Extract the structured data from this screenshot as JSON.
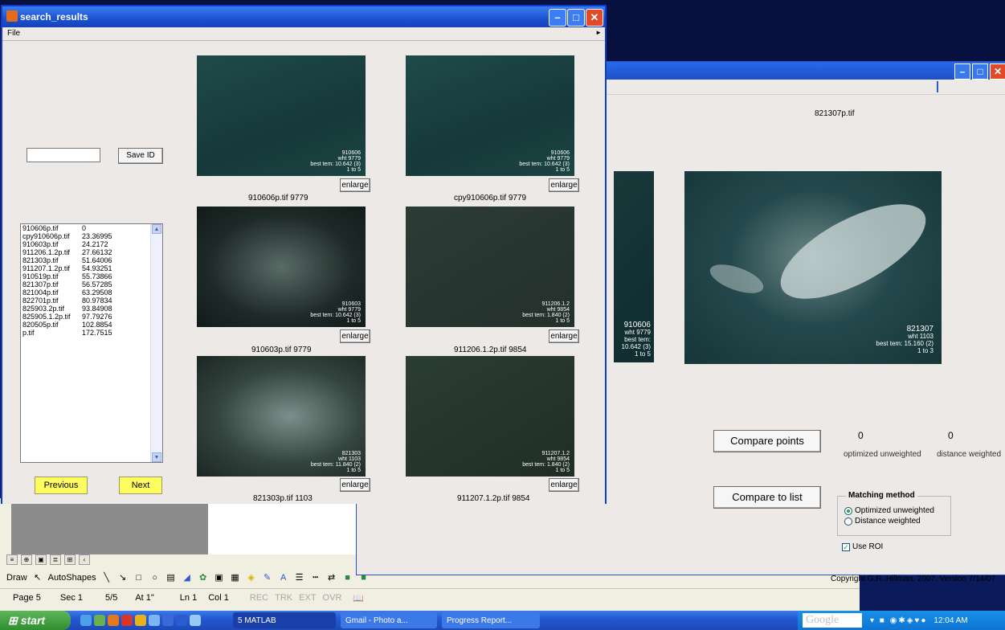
{
  "search_window": {
    "title": "search_results",
    "menu_file": "File",
    "save_id_label": "Save ID",
    "id_input_value": "",
    "results_list": [
      {
        "file": "910606p.tif",
        "score": "0"
      },
      {
        "file": "cpy910606p.tif",
        "score": "23.36995"
      },
      {
        "file": "910603p.tif",
        "score": "24.2172"
      },
      {
        "file": "911206.1.2p.tif",
        "score": "27.66132"
      },
      {
        "file": "821303p.tif",
        "score": "51.64006"
      },
      {
        "file": "911207.1.2p.tif",
        "score": "54.93251"
      },
      {
        "file": "910519p.tif",
        "score": "55.73866"
      },
      {
        "file": "821307p.tif",
        "score": "56.57285"
      },
      {
        "file": "821004p.tif",
        "score": "63.29508"
      },
      {
        "file": "822701p.tif",
        "score": "80.97834"
      },
      {
        "file": "825903.2p.tif",
        "score": "93.84908"
      },
      {
        "file": "825905.1.2p.tif",
        "score": "97.79276"
      },
      {
        "file": "820505p.tif",
        "score": "102.8854"
      },
      {
        "file": "p.tif",
        "score": "172.7515"
      }
    ],
    "previous_label": "Previous",
    "next_label": "Next",
    "enlarge_label": "enlarge",
    "thumbnails": [
      {
        "caption": "910606p.tif    9779",
        "overlay": [
          "910606",
          "wht 9779",
          "best tem: 10.642 (3)",
          "1 to 5"
        ]
      },
      {
        "caption": "cpy910606p.tif 9779",
        "overlay": [
          "910606",
          "wht 9779",
          "best tem: 10.642 (3)",
          "1 to 5"
        ]
      },
      {
        "caption": "910603p.tif 9779",
        "overlay": [
          "910603",
          "wht 9779",
          "best tem: 10.642 (3)",
          "1 to 5"
        ]
      },
      {
        "caption": "911206.1.2p.tif 9854",
        "overlay": [
          "911206.1.2",
          "wht 9854",
          "best tem: 1.840 (2)",
          "1 to 5"
        ]
      },
      {
        "caption": "821303p.tif 1103",
        "overlay": [
          "821303",
          "wht 1103",
          "best tem: 11.840 (2)",
          "1 to 5"
        ]
      },
      {
        "caption": "911207.1.2p.tif 9854",
        "overlay": [
          "911207.1.2",
          "wht 9854",
          "best tem: 1.840 (2)",
          "1 to 5"
        ]
      }
    ]
  },
  "compare_window": {
    "image_title": "821307p.tif",
    "left_overlay": [
      "910606",
      "wht 9779",
      "best tem: 10.642 (3)",
      "1 to 5"
    ],
    "right_overlay": [
      "821307",
      "wht 1103",
      "best tem: 15.160 (2)",
      "1 to 3"
    ],
    "compare_points_label": "Compare points",
    "compare_list_label": "Compare to list",
    "optimized_value": "0",
    "optimized_label": "optimized unweighted",
    "distance_value": "0",
    "distance_label": "distance weighted",
    "matching_method_title": "Matching method",
    "option_optimized": "Optimized unweighted",
    "option_distance": "Distance weighted",
    "selected_method": "Optimized unweighted",
    "use_roi_label": "Use ROI",
    "use_roi_checked": true,
    "copyright": "Copyright G.R. Hillman, 2007. Version 7/14/07"
  },
  "word_window": {
    "draw_label": "Draw",
    "autoshapes_label": "AutoShapes",
    "status": {
      "page": "Page 5",
      "sec": "Sec 1",
      "pages": "5/5",
      "at": "At 1\"",
      "ln": "Ln 1",
      "col": "Col 1",
      "rec": "REC",
      "trk": "TRK",
      "ext": "EXT",
      "ovr": "OVR"
    }
  },
  "taskbar": {
    "start_label": "start",
    "tasks": [
      "5 MATLAB",
      "Gmail - Photo a...",
      "Progress Report..."
    ],
    "search_placeholder": "Google",
    "clock": "12:04 AM"
  },
  "colors": {
    "title_blue": "#1a52d0",
    "window_bg": "#ece9e6",
    "nav_button_yellow": "#fdfd60",
    "taskbar_blue": "#2458d2",
    "start_green": "#3a9a38"
  }
}
